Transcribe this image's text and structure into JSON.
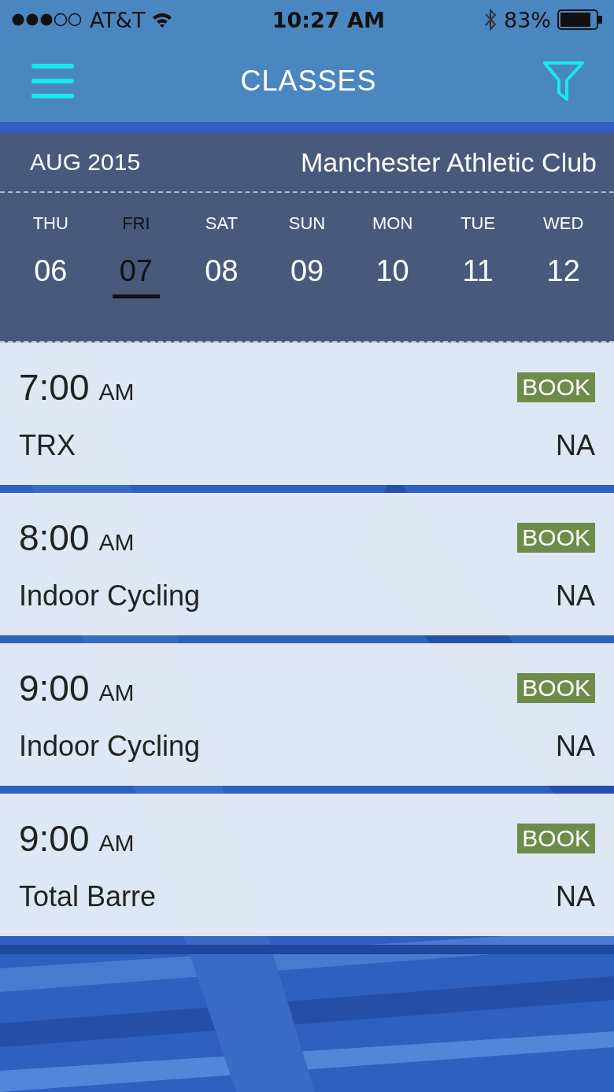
{
  "status_bar": {
    "carrier": "AT&T",
    "time": "10:27 AM",
    "battery": "83%"
  },
  "header": {
    "title": "CLASSES"
  },
  "calendar": {
    "month": "AUG",
    "year": "2015",
    "club": "Manchester Athletic Club",
    "days": [
      {
        "weekday": "THU",
        "date": "06",
        "selected": false
      },
      {
        "weekday": "FRI",
        "date": "07",
        "selected": true
      },
      {
        "weekday": "SAT",
        "date": "08",
        "selected": false
      },
      {
        "weekday": "SUN",
        "date": "09",
        "selected": false
      },
      {
        "weekday": "MON",
        "date": "10",
        "selected": false
      },
      {
        "weekday": "TUE",
        "date": "11",
        "selected": false
      },
      {
        "weekday": "WED",
        "date": "12",
        "selected": false
      }
    ]
  },
  "classes": [
    {
      "time": "7:00",
      "period": "AM",
      "name": "TRX",
      "button": "BOOK",
      "instructor": "NA"
    },
    {
      "time": "8:00",
      "period": "AM",
      "name": "Indoor Cycling",
      "button": "BOOK",
      "instructor": "NA"
    },
    {
      "time": "9:00",
      "period": "AM",
      "name": "Indoor Cycling",
      "button": "BOOK",
      "instructor": "NA"
    },
    {
      "time": "9:00",
      "period": "AM",
      "name": "Total Barre",
      "button": "BOOK",
      "instructor": "NA"
    }
  ]
}
